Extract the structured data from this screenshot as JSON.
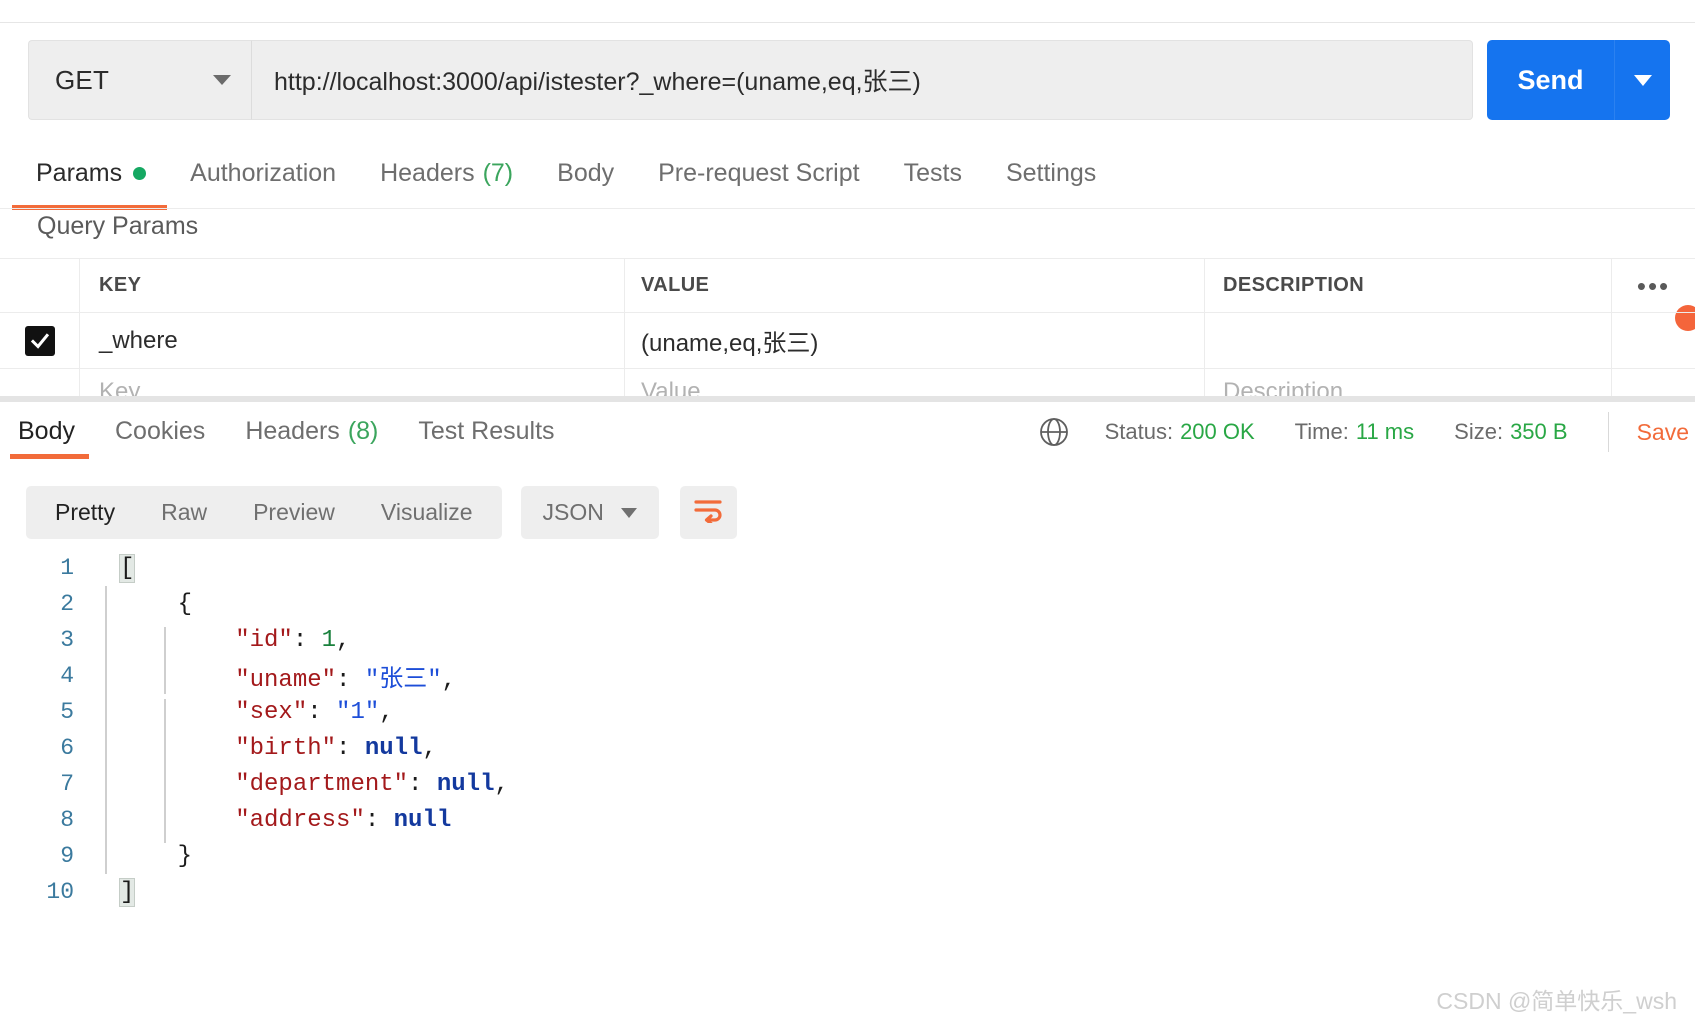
{
  "request": {
    "method": "GET",
    "method_caret_icon": "chevron-down-icon",
    "url": "http://localhost:3000/api/istester?_where=(uname,eq,张三)",
    "send_label": "Send",
    "send_caret_icon": "chevron-down-icon"
  },
  "request_tabs": [
    {
      "label": "Params",
      "dot": true,
      "active": true
    },
    {
      "label": "Authorization",
      "active": false
    },
    {
      "label": "Headers",
      "count": "(7)",
      "active": false
    },
    {
      "label": "Body",
      "active": false
    },
    {
      "label": "Pre-request Script",
      "active": false
    },
    {
      "label": "Tests",
      "active": false
    },
    {
      "label": "Settings",
      "active": false
    }
  ],
  "query_params": {
    "title": "Query Params",
    "columns": [
      "KEY",
      "VALUE",
      "DESCRIPTION"
    ],
    "more_icon": "•••",
    "rows": [
      {
        "checked": true,
        "key": "_where",
        "value": "(uname,eq,张三)",
        "description": ""
      }
    ],
    "placeholder_row": {
      "key": "Key",
      "value": "Value",
      "description": "Description"
    }
  },
  "response_tabs": [
    {
      "label": "Body",
      "active": true
    },
    {
      "label": "Cookies",
      "active": false
    },
    {
      "label": "Headers",
      "count": "(8)",
      "active": false
    },
    {
      "label": "Test Results",
      "active": false
    }
  ],
  "response_meta": {
    "globe_icon": "globe-icon",
    "status_label": "Status:",
    "status_value": "200 OK",
    "time_label": "Time:",
    "time_value": "11 ms",
    "size_label": "Size:",
    "size_value": "350 B",
    "save_label": "Save"
  },
  "body_toolbar": {
    "views": [
      "Pretty",
      "Raw",
      "Preview",
      "Visualize"
    ],
    "active_view": "Pretty",
    "format": "JSON",
    "format_caret_icon": "chevron-down-icon",
    "wrap_icon": "wrap-text-icon"
  },
  "response_body": {
    "language": "json",
    "lines": [
      {
        "n": "1",
        "tokens": [
          {
            "t": "[",
            "c": "punct",
            "hl": true
          }
        ]
      },
      {
        "n": "2",
        "tokens": [
          {
            "t": "    ",
            "c": "punct"
          },
          {
            "t": "{",
            "c": "punct"
          }
        ]
      },
      {
        "n": "3",
        "tokens": [
          {
            "t": "        ",
            "c": "punct"
          },
          {
            "t": "\"id\"",
            "c": "key"
          },
          {
            "t": ": ",
            "c": "punct"
          },
          {
            "t": "1",
            "c": "num"
          },
          {
            "t": ",",
            "c": "punct"
          }
        ]
      },
      {
        "n": "4",
        "tokens": [
          {
            "t": "        ",
            "c": "punct"
          },
          {
            "t": "\"uname\"",
            "c": "key"
          },
          {
            "t": ": ",
            "c": "punct"
          },
          {
            "t": "\"张三\"",
            "c": "str"
          },
          {
            "t": ",",
            "c": "punct"
          }
        ]
      },
      {
        "n": "5",
        "tokens": [
          {
            "t": "        ",
            "c": "punct"
          },
          {
            "t": "\"sex\"",
            "c": "key"
          },
          {
            "t": ": ",
            "c": "punct"
          },
          {
            "t": "\"1\"",
            "c": "str"
          },
          {
            "t": ",",
            "c": "punct"
          }
        ]
      },
      {
        "n": "6",
        "tokens": [
          {
            "t": "        ",
            "c": "punct"
          },
          {
            "t": "\"birth\"",
            "c": "key"
          },
          {
            "t": ": ",
            "c": "punct"
          },
          {
            "t": "null",
            "c": "null"
          },
          {
            "t": ",",
            "c": "punct"
          }
        ]
      },
      {
        "n": "7",
        "tokens": [
          {
            "t": "        ",
            "c": "punct"
          },
          {
            "t": "\"department\"",
            "c": "key"
          },
          {
            "t": ": ",
            "c": "punct"
          },
          {
            "t": "null",
            "c": "null"
          },
          {
            "t": ",",
            "c": "punct"
          }
        ]
      },
      {
        "n": "8",
        "tokens": [
          {
            "t": "        ",
            "c": "punct"
          },
          {
            "t": "\"address\"",
            "c": "key"
          },
          {
            "t": ": ",
            "c": "punct"
          },
          {
            "t": "null",
            "c": "null"
          }
        ]
      },
      {
        "n": "9",
        "tokens": [
          {
            "t": "    ",
            "c": "punct"
          },
          {
            "t": "}",
            "c": "punct"
          }
        ]
      },
      {
        "n": "10",
        "tokens": [
          {
            "t": "]",
            "c": "punct",
            "hl": true
          }
        ]
      }
    ]
  },
  "watermark": "CSDN @简单快乐_wsh",
  "colors": {
    "accent_orange": "#f26b3a",
    "send_blue": "#1574ef",
    "status_green": "#29a745",
    "json_key": "#a3191b",
    "json_string": "#1d4ed8",
    "json_number": "#19803c",
    "json_null": "#13399e"
  }
}
